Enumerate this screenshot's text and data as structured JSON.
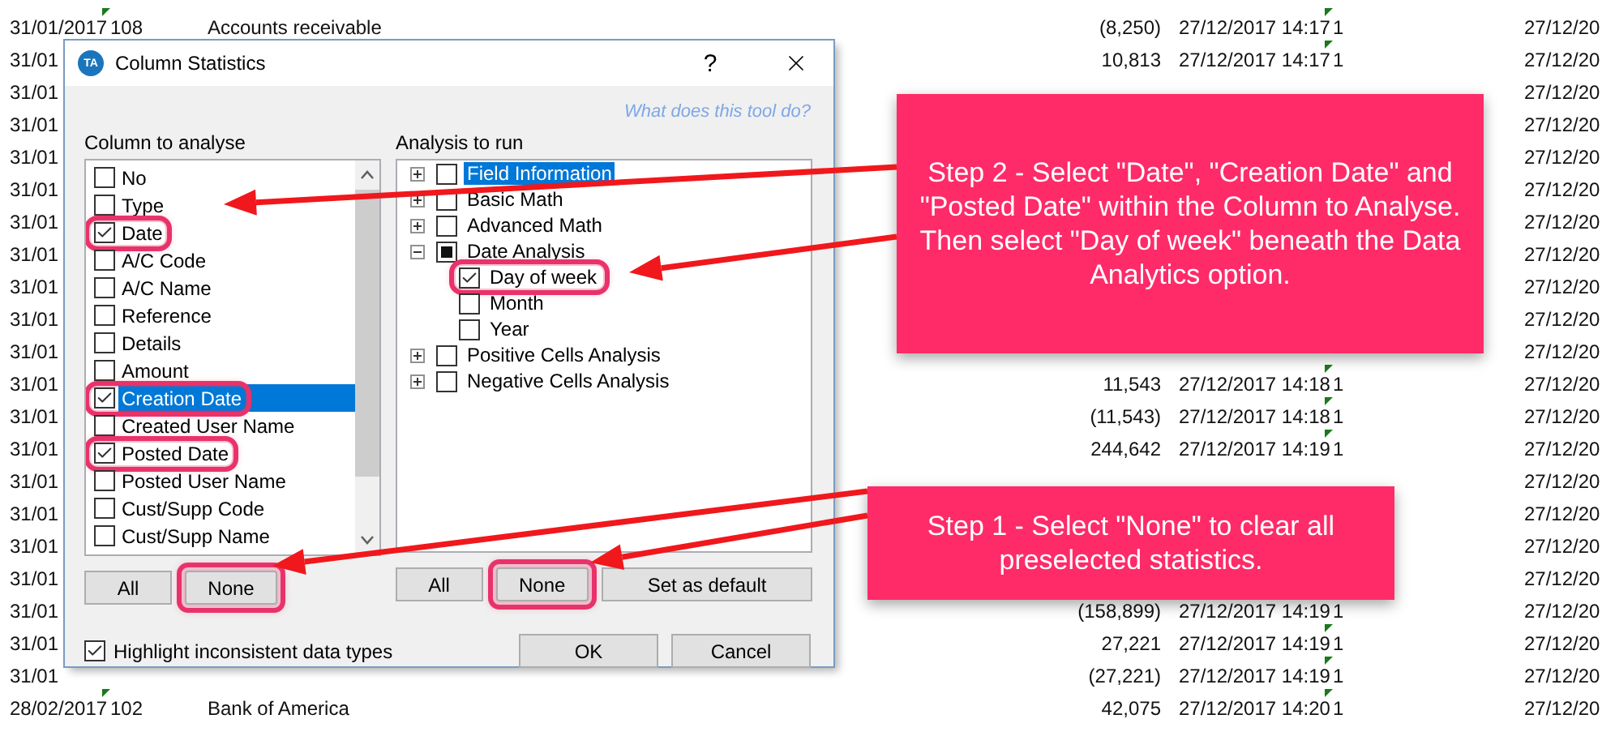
{
  "spreadsheet": {
    "rows": [
      {
        "date": "31/01/2017",
        "code": "108",
        "name": "Accounts receivable",
        "amount": "(8,250)",
        "posted": "27/12/2017 14:17",
        "flag": "1",
        "column_7": "27/12/20"
      },
      {
        "date": "31/01",
        "amount": "10,813",
        "posted": "27/12/2017 14:17",
        "flag": "1",
        "column_7": "27/12/20"
      },
      {
        "date": "31/01",
        "column_7": "27/12/20"
      },
      {
        "date": "31/01",
        "column_7": "27/12/20"
      },
      {
        "date": "31/01",
        "column_7": "27/12/20"
      },
      {
        "date": "31/01",
        "column_7": "27/12/20"
      },
      {
        "date": "31/01",
        "column_7": "27/12/20"
      },
      {
        "date": "31/01",
        "column_7": "27/12/20"
      },
      {
        "date": "31/01",
        "column_7": "27/12/20"
      },
      {
        "date": "31/01",
        "column_7": "27/12/20"
      },
      {
        "date": "31/01",
        "column_7": "27/12/20"
      },
      {
        "date": "31/01",
        "amount": "11,543",
        "posted": "27/12/2017 14:18",
        "flag": "1",
        "column_7": "27/12/20"
      },
      {
        "date": "31/01",
        "amount": "(11,543)",
        "posted": "27/12/2017 14:18",
        "flag": "1",
        "column_7": "27/12/20"
      },
      {
        "date": "31/01",
        "amount": "244,642",
        "posted": "27/12/2017 14:19",
        "flag": "1",
        "column_7": "27/12/20"
      },
      {
        "date": "31/01",
        "column_7": "27/12/20"
      },
      {
        "date": "31/01",
        "column_7": "27/12/20"
      },
      {
        "date": "31/01",
        "column_7": "27/12/20"
      },
      {
        "date": "31/01",
        "column_7": "27/12/20"
      },
      {
        "date": "31/01",
        "amount": "(158,899)",
        "posted": "27/12/2017 14:19",
        "flag": "1",
        "column_7": "27/12/20"
      },
      {
        "date": "31/01",
        "amount": "27,221",
        "posted": "27/12/2017 14:19",
        "flag": "1",
        "column_7": "27/12/20"
      },
      {
        "date": "31/01",
        "amount": "(27,221)",
        "posted": "27/12/2017 14:19",
        "flag": "1",
        "column_7": "27/12/20"
      },
      {
        "date": "28/02/2017",
        "code": "102",
        "name": "Bank of America",
        "amount": "42,075",
        "posted": "27/12/2017 14:20",
        "flag": "1",
        "column_7": "27/12/20"
      }
    ]
  },
  "dialog": {
    "icon_label": "TA",
    "title": "Column Statistics",
    "help_button": "?",
    "help_link": "What does this tool do?",
    "columns_panel": {
      "label": "Column to analyse",
      "items": [
        {
          "label": "No",
          "checked": false,
          "selected": false,
          "highlighted": false
        },
        {
          "label": "Type",
          "checked": false,
          "selected": false,
          "highlighted": false
        },
        {
          "label": "Date",
          "checked": true,
          "selected": false,
          "highlighted": true
        },
        {
          "label": "A/C Code",
          "checked": false,
          "selected": false,
          "highlighted": false
        },
        {
          "label": "A/C Name",
          "checked": false,
          "selected": false,
          "highlighted": false
        },
        {
          "label": "Reference",
          "checked": false,
          "selected": false,
          "highlighted": false
        },
        {
          "label": "Details",
          "checked": false,
          "selected": false,
          "highlighted": false
        },
        {
          "label": "Amount",
          "checked": false,
          "selected": false,
          "highlighted": false
        },
        {
          "label": "Creation Date",
          "checked": true,
          "selected": true,
          "highlighted": true
        },
        {
          "label": "Created User Name",
          "checked": false,
          "selected": false,
          "highlighted": false
        },
        {
          "label": "Posted Date",
          "checked": true,
          "selected": false,
          "highlighted": true
        },
        {
          "label": "Posted User Name",
          "checked": false,
          "selected": false,
          "highlighted": false
        },
        {
          "label": "Cust/Supp Code",
          "checked": false,
          "selected": false,
          "highlighted": false
        },
        {
          "label": "Cust/Supp Name",
          "checked": false,
          "selected": false,
          "highlighted": false
        }
      ],
      "buttons": [
        {
          "label": "All",
          "highlighted": false
        },
        {
          "label": "None",
          "highlighted": true
        }
      ]
    },
    "analysis_panel": {
      "label": "Analysis to run",
      "items": [
        {
          "label": "Field Information",
          "checked": false,
          "indeterminate": false,
          "selected": true,
          "highlighted": false,
          "expanded": false
        },
        {
          "label": "Basic Math",
          "checked": false,
          "indeterminate": false,
          "selected": false,
          "highlighted": false,
          "expanded": false
        },
        {
          "label": "Advanced Math",
          "checked": false,
          "indeterminate": false,
          "selected": false,
          "highlighted": false,
          "expanded": false
        },
        {
          "label": "Date Analysis",
          "checked": false,
          "indeterminate": true,
          "selected": false,
          "highlighted": false,
          "expanded": true,
          "children": [
            {
              "label": "Day of week",
              "checked": true,
              "indeterminate": false,
              "selected": false,
              "highlighted": true
            },
            {
              "label": "Month",
              "checked": false,
              "indeterminate": false,
              "selected": false,
              "highlighted": false
            },
            {
              "label": "Year",
              "checked": false,
              "indeterminate": false,
              "selected": false,
              "highlighted": false
            }
          ]
        },
        {
          "label": "Positive Cells Analysis",
          "checked": false,
          "indeterminate": false,
          "selected": false,
          "highlighted": false,
          "expanded": false
        },
        {
          "label": "Negative Cells Analysis",
          "checked": false,
          "indeterminate": false,
          "selected": false,
          "highlighted": false,
          "expanded": false
        }
      ],
      "buttons": [
        {
          "label": "All",
          "highlighted": false
        },
        {
          "label": "None",
          "highlighted": true
        },
        {
          "label": "Set as default",
          "highlighted": false
        }
      ]
    },
    "highlight_option": {
      "label": "Highlight inconsistent data types",
      "checked": true
    },
    "ok_button": "OK",
    "cancel_button": "Cancel"
  },
  "callouts": [
    {
      "text": "Step 2 - Select \"Date\", \"Creation Date\" and \"Posted Date\" within the Column to Analyse. Then select \"Day of week\" beneath the Data Analytics option."
    },
    {
      "text": "Step 1 - Select \"None\" to clear all preselected statistics."
    }
  ]
}
